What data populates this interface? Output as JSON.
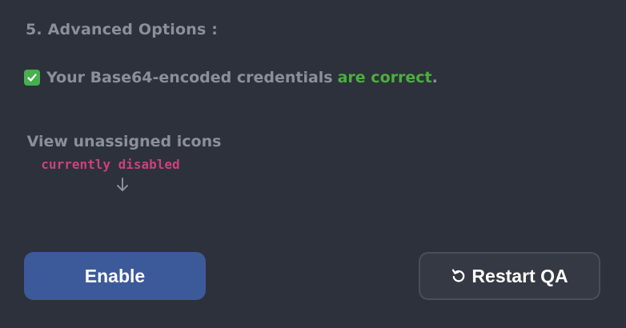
{
  "section": {
    "title": "5. Advanced Options :"
  },
  "status": {
    "icon": "check-mark-icon",
    "prefix": "Your Base64-encoded credentials",
    "highlight": "are correct",
    "suffix": ".",
    "highlight_color": "#4cae3f"
  },
  "unassigned": {
    "label": "View unassigned icons",
    "state": "currently disabled",
    "state_color": "#cf3f7d",
    "arrow_icon": "arrow-down-icon"
  },
  "buttons": {
    "enable_label": "Enable",
    "restart_label": "Restart QA",
    "restart_icon": "refresh-icon",
    "enable_color": "#3c5a9a"
  }
}
